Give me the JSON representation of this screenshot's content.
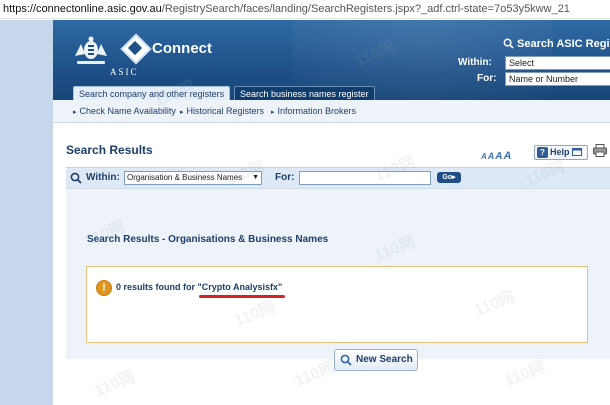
{
  "browser": {
    "url_domain": "https://connectonline.asic.gov.au",
    "url_path": "/RegistrySearch/faces/landing/SearchRegisters.jspx?_adf.ctrl-state=7o53y5kww_21"
  },
  "header": {
    "org": "ASIC",
    "brand": "Connect",
    "search_title": "Search ASIC Regist",
    "within_label": "Within:",
    "within_value": "Select",
    "for_label": "For:",
    "for_placeholder": "Name or Number",
    "tabs": [
      {
        "label": "Search company and other registers"
      },
      {
        "label": "Search business names register"
      }
    ]
  },
  "subnav": [
    {
      "label": "Check Name Availability"
    },
    {
      "label": "Historical Registers"
    },
    {
      "label": "Information Brokers"
    }
  ],
  "content": {
    "title": "Search Results",
    "font_sizer": [
      "A",
      "A",
      "A",
      "A"
    ],
    "help_label": "Help",
    "within_label": "Within:",
    "within_value": "Organisation & Business Names",
    "for_label": "For:",
    "for_value": "",
    "go_label": "Go",
    "panel_title": "Search Results - Organisations & Business Names",
    "result_prefix": "0 results found for ",
    "result_query": "\"Crypto Analysisfx\"",
    "new_search_label": "New Search"
  },
  "watermark": "110网",
  "colors": {
    "header_blue": "#1e5189",
    "accent_text": "#1d3f6b",
    "warning_orange": "#e0961e",
    "annotation_red": "#d62222"
  }
}
